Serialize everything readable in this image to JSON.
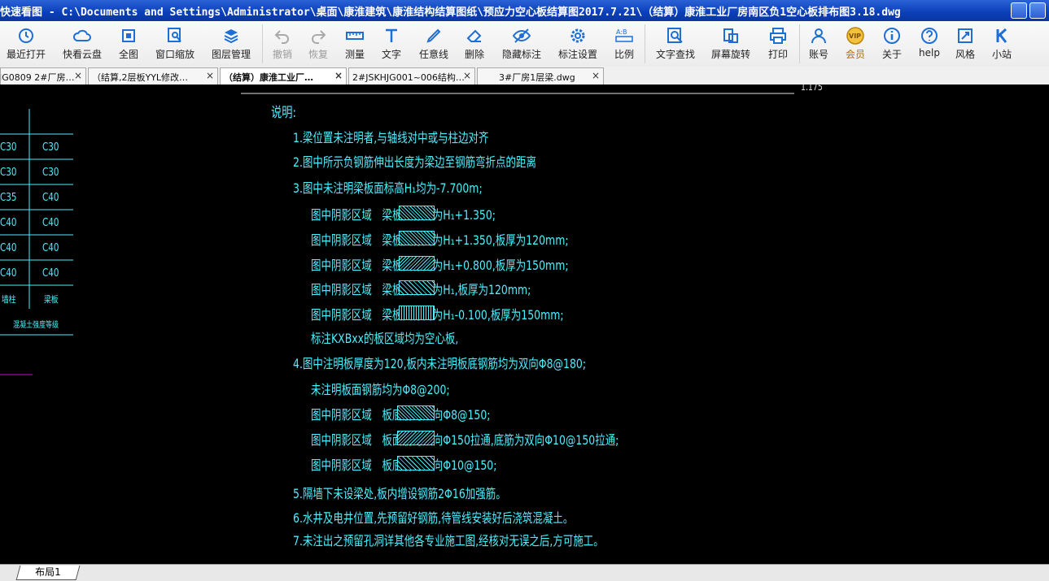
{
  "window": {
    "title": "快速看图 - C:\\Documents and Settings\\Administrator\\桌面\\康淮建筑\\康淮结构结算图纸\\预应力空心板结算图2017.7.21\\（结算）康淮工业厂房南区负1空心板排布图3.18.dwg"
  },
  "toolbar": {
    "items": [
      {
        "label": "最近打开",
        "icon": "history-icon"
      },
      {
        "label": "快看云盘",
        "icon": "cloud-icon"
      },
      {
        "label": "全图",
        "icon": "fit-all-icon"
      },
      {
        "label": "窗口缩放",
        "icon": "zoom-window-icon"
      },
      {
        "label": "图层管理",
        "icon": "layers-icon"
      },
      {
        "label": "撤销",
        "icon": "undo-icon"
      },
      {
        "label": "恢复",
        "icon": "redo-icon"
      },
      {
        "label": "测量",
        "icon": "ruler-icon"
      },
      {
        "label": "文字",
        "icon": "text-icon"
      },
      {
        "label": "任意线",
        "icon": "pen-icon"
      },
      {
        "label": "删除",
        "icon": "eraser-icon"
      },
      {
        "label": "隐藏标注",
        "icon": "eye-hide-icon"
      },
      {
        "label": "标注设置",
        "icon": "gear-icon"
      },
      {
        "label": "比例",
        "icon": "scale-icon"
      },
      {
        "label": "文字查找",
        "icon": "search-text-icon"
      },
      {
        "label": "屏幕旋转",
        "icon": "rotate-icon"
      },
      {
        "label": "打印",
        "icon": "printer-icon"
      },
      {
        "label": "账号",
        "icon": "user-icon"
      },
      {
        "label": "会员",
        "icon": "vip-icon"
      },
      {
        "label": "关于",
        "icon": "info-icon"
      },
      {
        "label": "help",
        "icon": "help-icon"
      },
      {
        "label": "风格",
        "icon": "style-icon"
      },
      {
        "label": "小站",
        "icon": "k-logo-icon"
      }
    ]
  },
  "tabs": [
    {
      "label": "JG0809 2#厂房…",
      "close": "×"
    },
    {
      "label": "（结算,2层板YYL修改…",
      "close": "×"
    },
    {
      "label": "（结算）康淮工业厂…",
      "close": "×"
    },
    {
      "label": "2#JSKHJG001~006结构…",
      "close": "×"
    },
    {
      "label": "3#厂房1层梁.dwg",
      "close": "×"
    }
  ],
  "drawing": {
    "heading": "说明:",
    "notes": [
      "1.梁位置未注明者,与轴线对中或与柱边对齐",
      "2.图中所示负钢筋伸出长度为梁边至钢筋弯折点的距离",
      "3.图中未注明梁板面标高H₁均为-7.700m;",
      "图中阴影区域　梁板面标高为H₁+1.350;",
      "图中阴影区域　梁板面标高为H₁+1.350,板厚为120mm;",
      "图中阴影区域　梁板面标高为H₁+0.800,板厚为150mm;",
      "图中阴影区域　梁板面标高为H₁,板厚为120mm;",
      "图中阴影区域　梁板面标高为H₁-0.100,板厚为150mm;",
      "标注KXBxx的板区域均为空心板,",
      "4.图中注明板厚度为120,板内未注明板底钢筋均为双向Φ8@180;",
      "未注明板面钢筋均为Φ8@200;",
      "图中阴影区域　板底筋为双向Φ8@150;",
      "图中阴影区域　板面筋为双向Φ150拉通,底筋为双向Φ10@150拉通;",
      "图中阴影区域　板底筋为双向Φ10@150;",
      "5.隔墙下未设梁处,板内增设钢筋2Φ16加强筋。",
      "6.水井及电井位置,先预留好钢筋,待管线安装好后浇筑混凝土。",
      "7.未注出之预留孔洞详其他各专业施工图,经核对无误之后,方可施工。"
    ],
    "table": {
      "rows": [
        [
          "C30",
          "C30"
        ],
        [
          "C30",
          "C30"
        ],
        [
          "C35",
          "C40"
        ],
        [
          "C40",
          "C40"
        ],
        [
          "C40",
          "C40"
        ],
        [
          "C40",
          "C40"
        ],
        [
          "墙柱",
          "梁板"
        ]
      ],
      "footer": "混凝土强度等级"
    },
    "top_right_label": "1.175"
  },
  "status": {
    "layout_tab": "布局1"
  }
}
